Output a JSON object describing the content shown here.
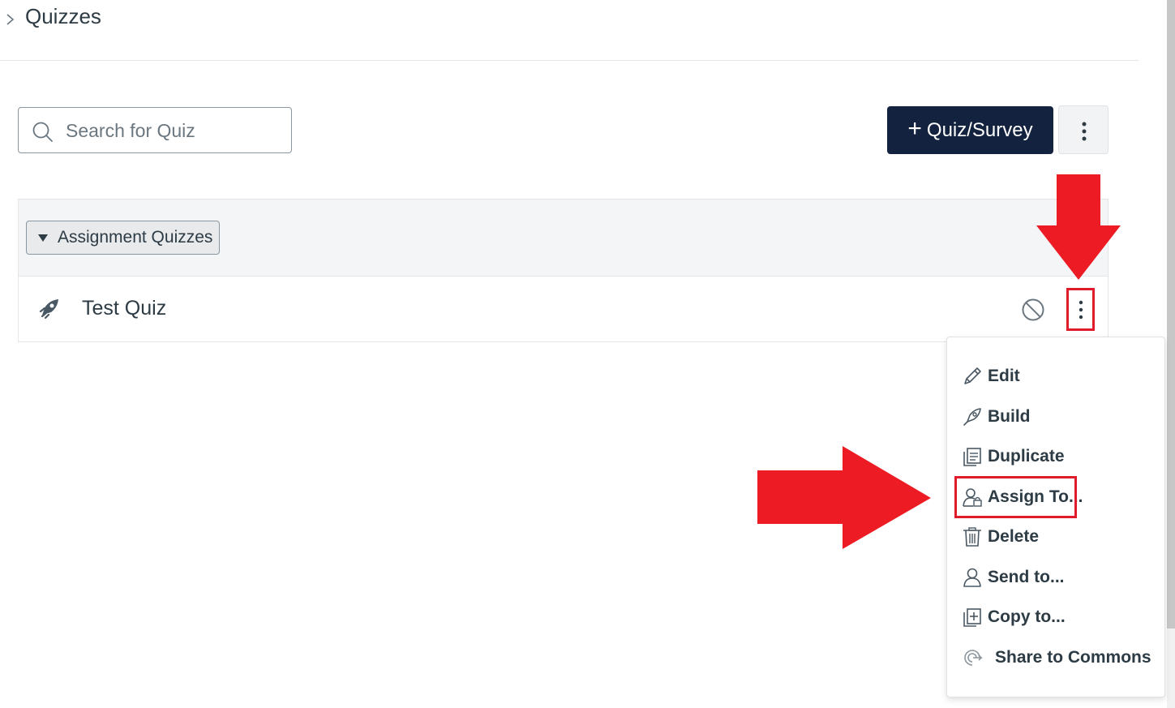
{
  "breadcrumb": {
    "current": "Quizzes"
  },
  "search": {
    "placeholder": "Search for Quiz",
    "value": ""
  },
  "toolbar": {
    "add_quiz_label": "Quiz/Survey"
  },
  "group": {
    "title": "Assignment Quizzes"
  },
  "quizzes": [
    {
      "title": "Test Quiz",
      "status": "unpublished"
    }
  ],
  "menu": {
    "items": [
      {
        "label": "Edit",
        "icon": "pencil-icon"
      },
      {
        "label": "Build",
        "icon": "rocket-icon"
      },
      {
        "label": "Duplicate",
        "icon": "duplicate-icon"
      },
      {
        "label": "Assign To...",
        "icon": "assign-user-icon"
      },
      {
        "label": "Delete",
        "icon": "trash-icon"
      },
      {
        "label": "Send to...",
        "icon": "user-icon"
      },
      {
        "label": "Copy to...",
        "icon": "copy-add-icon"
      },
      {
        "label": "Share to Commons",
        "icon": "commons-icon"
      }
    ]
  },
  "colors": {
    "primary_button": "#13233f",
    "annotation_red": "#e01c2c",
    "text": "#2d3b45"
  }
}
